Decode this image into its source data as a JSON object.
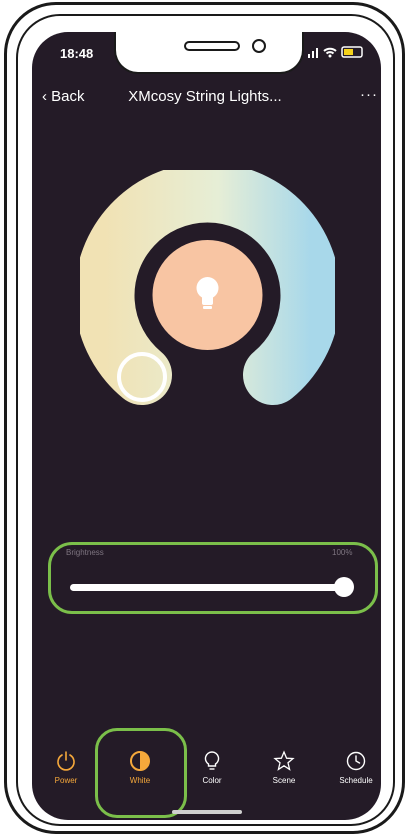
{
  "status_bar": {
    "time": "18:48"
  },
  "nav": {
    "back_label": "Back",
    "title": "XMcosy String Lights...",
    "more_label": "···"
  },
  "color_wheel": {
    "knob_position": "left-bottom (warm white)"
  },
  "brightness": {
    "label": "Brightness",
    "value": "100%",
    "level": 1.0
  },
  "tabs": [
    {
      "label": "Power",
      "icon": "power-icon"
    },
    {
      "label": "White",
      "icon": "white-mode-icon",
      "active": true
    },
    {
      "label": "Color",
      "icon": "bulb-icon"
    },
    {
      "label": "Scene",
      "icon": "star-icon"
    },
    {
      "label": "Schedule",
      "icon": "clock-icon"
    }
  ],
  "colors": {
    "screen_bg": "#241b27",
    "accent": "#f5a83b",
    "highlight": "#7bbf4a",
    "center_disc": "#f8c5a3"
  }
}
